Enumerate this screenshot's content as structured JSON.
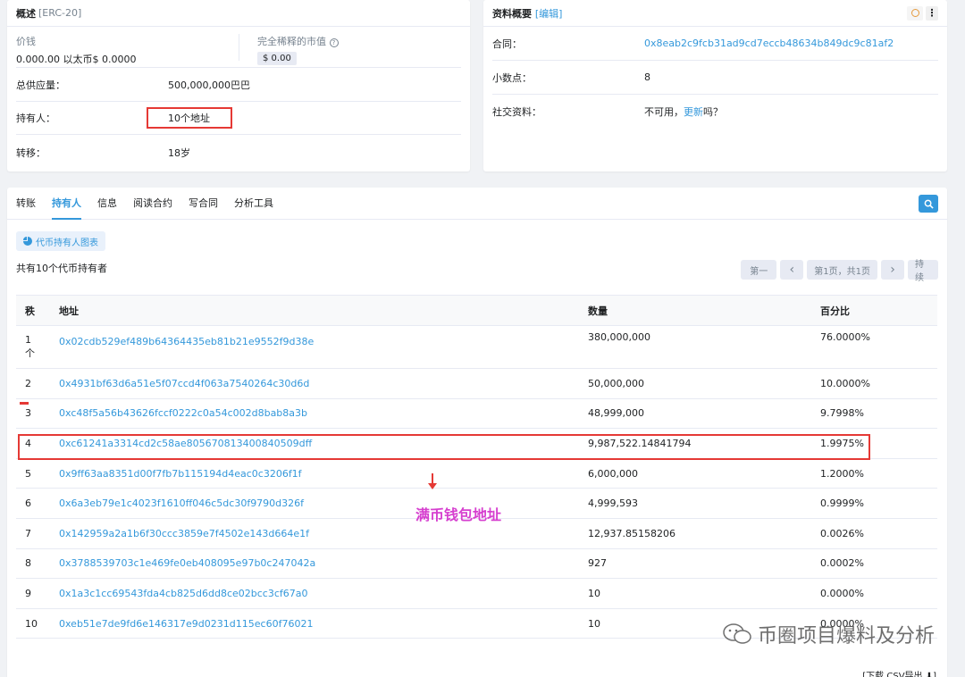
{
  "overview": {
    "title": "概述",
    "standard": "[ERC-20]",
    "price_label": "价钱",
    "price_value": "0.000.00 以太币$ 0.0000",
    "mcap_label": "完全稀释的市值",
    "mcap_value": "$ 0.00",
    "supply_label": "总供应量：",
    "supply_value": "500,000,000巴巴",
    "holders_label": "持有人：",
    "holders_value": "10个地址",
    "transfers_label": "转移：",
    "transfers_value": "18岁"
  },
  "profile": {
    "title": "资料概要",
    "edit_label": "[编辑]",
    "contract_label": "合同：",
    "contract_value": "0x8eab2c9fcb31ad9cd7eccb48634b849dc9c81af2",
    "decimals_label": "小数点：",
    "decimals_value": "8",
    "social_label": "社交资料：",
    "social_text_before": "不可用，",
    "social_link": "更新",
    "social_text_after": "吗？"
  },
  "tabs": [
    "转账",
    "持有人",
    "信息",
    "阅读合约",
    "写合同",
    "分析工具"
  ],
  "holders_panel": {
    "chart_button": "代币持有人图表",
    "summary": "共有10个代币持有者",
    "pagination": {
      "first": "第一",
      "prev": "‹",
      "page": "第1页，共1页",
      "next": "›",
      "last": "持续"
    },
    "columns": [
      "秩",
      "地址",
      "数量",
      "百分比"
    ],
    "rows": [
      {
        "rank": "1",
        "rank_suffix": "个",
        "address": "0x02cdb529ef489b64364435eb81b21e9552f9d38e",
        "quantity": "380,000,000",
        "percentage": "76.0000%"
      },
      {
        "rank": "2",
        "address": "0x4931bf63d6a51e5f07ccd4f063a7540264c30d6d",
        "quantity": "50,000,000",
        "percentage": "10.0000%"
      },
      {
        "rank": "3",
        "address": "0xc48f5a56b43626fccf0222c0a54c002d8bab8a3b",
        "quantity": "48,999,000",
        "percentage": "9.7998%"
      },
      {
        "rank": "4",
        "address": "0xc61241a3314cd2c58ae805670813400840509dff",
        "quantity": "9,987,522.14841794",
        "percentage": "1.9975%"
      },
      {
        "rank": "5",
        "address": "0x9ff63aa8351d00f7fb7b115194d4eac0c3206f1f",
        "quantity": "6,000,000",
        "percentage": "1.2000%"
      },
      {
        "rank": "6",
        "address": "0x6a3eb79e1c4023f1610ff046c5dc30f9790d326f",
        "quantity": "4,999,593",
        "percentage": "0.9999%"
      },
      {
        "rank": "7",
        "address": "0x142959a2a1b6f30ccc3859e7f4502e143d664e1f",
        "quantity": "12,937.85158206",
        "percentage": "0.0026%"
      },
      {
        "rank": "8",
        "address": "0x3788539703c1e469fe0eb408095e97b0c247042a",
        "quantity": "927",
        "percentage": "0.0002%"
      },
      {
        "rank": "9",
        "address": "0x1a3c1cc69543fda4cb825d6dd8ce02bcc3cf67a0",
        "quantity": "10",
        "percentage": "0.0000%"
      },
      {
        "rank": "10",
        "address": "0xeb51e7de9fd6e146317e9d0231d115ec60f76021",
        "quantity": "10",
        "percentage": "0.0000%"
      }
    ],
    "footer_download": "[下载 CSV导出 ⬇]"
  },
  "annotation": "满币钱包地址",
  "watermark": "币圈项目爆料及分析",
  "colors": {
    "link": "#3498db",
    "highlight": "#e53935",
    "annotation": "#d63fcf"
  }
}
